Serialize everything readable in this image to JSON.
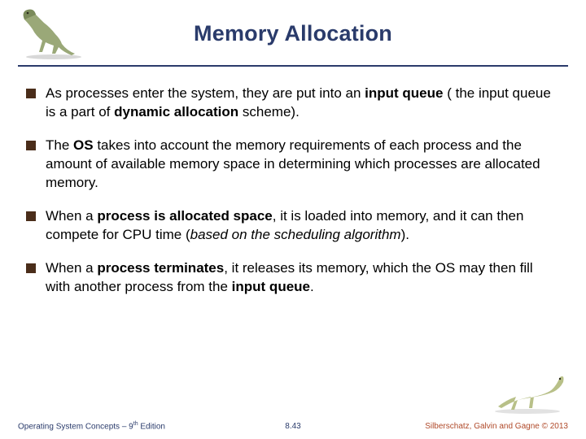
{
  "title": "Memory Allocation",
  "bullets": [
    {
      "html": "As processes enter the system, they are put into an <b>input queue</b> ( the input queue is a part of <b>dynamic allocation</b> scheme)."
    },
    {
      "html": "The <b>OS</b> takes into account the memory requirements of each process and the amount of available memory space in determining which processes are allocated memory."
    },
    {
      "html": "When a <b>process is allocated space</b>, it is loaded into memory, and it can then compete for CPU time (<i>based on the scheduling algorithm</i>)."
    },
    {
      "html": "When a <b>process terminates</b>, it releases its memory, which the OS may then fill with another process from the <b>input queue</b>."
    }
  ],
  "footer": {
    "left_pre": "Operating System Concepts – 9",
    "left_sup": "th",
    "left_post": " Edition",
    "center": "8.43",
    "right": "Silberschatz, Galvin and Gagne © 2013"
  }
}
